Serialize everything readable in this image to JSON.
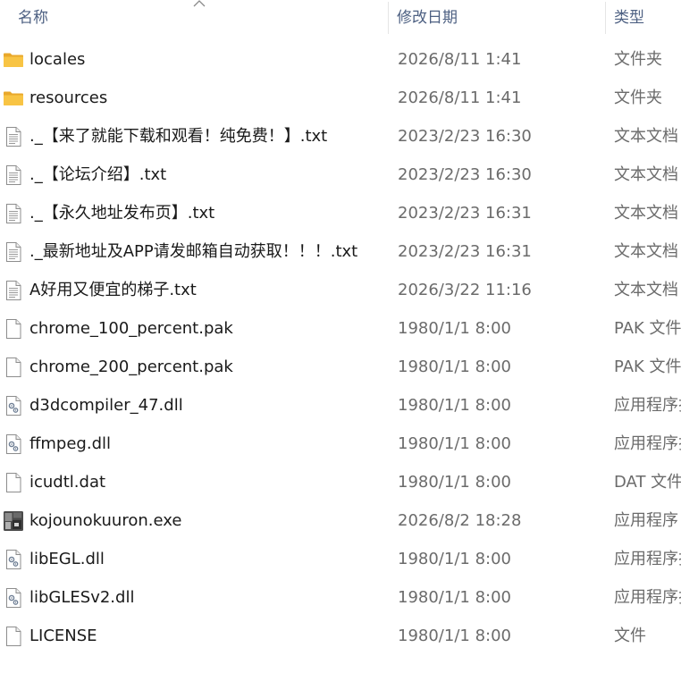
{
  "columns": {
    "name": "名称",
    "date_modified": "修改日期",
    "type": "类型"
  },
  "files": [
    {
      "name": "locales",
      "date": "2026/8/11 1:41",
      "type": "文件夹",
      "icon": "folder-icon"
    },
    {
      "name": "resources",
      "date": "2026/8/11 1:41",
      "type": "文件夹",
      "icon": "folder-icon"
    },
    {
      "name": "._【来了就能下载和观看！纯免费！】.txt",
      "date": "2023/2/23 16:30",
      "type": "文本文档",
      "icon": "text-file-icon"
    },
    {
      "name": "._【论坛介绍】.txt",
      "date": "2023/2/23 16:30",
      "type": "文本文档",
      "icon": "text-file-icon"
    },
    {
      "name": "._【永久地址发布页】.txt",
      "date": "2023/2/23 16:31",
      "type": "文本文档",
      "icon": "text-file-icon"
    },
    {
      "name": "._最新地址及APP请发邮箱自动获取！！！.txt",
      "date": "2023/2/23 16:31",
      "type": "文本文档",
      "icon": "text-file-icon"
    },
    {
      "name": "A好用又便宜的梯子.txt",
      "date": "2026/3/22 11:16",
      "type": "文本文档",
      "icon": "text-file-icon"
    },
    {
      "name": "chrome_100_percent.pak",
      "date": "1980/1/1 8:00",
      "type": "PAK 文件",
      "icon": "blank-file-icon"
    },
    {
      "name": "chrome_200_percent.pak",
      "date": "1980/1/1 8:00",
      "type": "PAK 文件",
      "icon": "blank-file-icon"
    },
    {
      "name": "d3dcompiler_47.dll",
      "date": "1980/1/1 8:00",
      "type": "应用程序扩展",
      "icon": "dll-file-icon"
    },
    {
      "name": "ffmpeg.dll",
      "date": "1980/1/1 8:00",
      "type": "应用程序扩展",
      "icon": "dll-file-icon"
    },
    {
      "name": "icudtl.dat",
      "date": "1980/1/1 8:00",
      "type": "DAT 文件",
      "icon": "blank-file-icon"
    },
    {
      "name": "kojounokuuron.exe",
      "date": "2026/8/2 18:28",
      "type": "应用程序",
      "icon": "exe-app-icon"
    },
    {
      "name": "libEGL.dll",
      "date": "1980/1/1 8:00",
      "type": "应用程序扩展",
      "icon": "dll-file-icon"
    },
    {
      "name": "libGLESv2.dll",
      "date": "1980/1/1 8:00",
      "type": "应用程序扩展",
      "icon": "dll-file-icon"
    },
    {
      "name": "LICENSE",
      "date": "1980/1/1 8:00",
      "type": "文件",
      "icon": "blank-file-icon"
    }
  ],
  "colors": {
    "folder": "#f8c444",
    "header_text": "#4d6082",
    "secondary_text": "#6b6b6b"
  }
}
